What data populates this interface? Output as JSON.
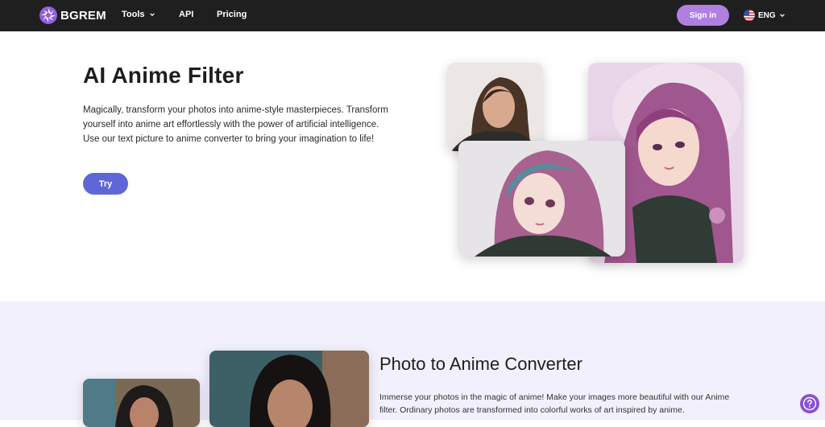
{
  "nav": {
    "logo_text": "BGREM",
    "items": [
      {
        "label": "Tools"
      },
      {
        "label": "API"
      },
      {
        "label": "Pricing"
      }
    ],
    "signin_label": "Sign in",
    "language": "ENG"
  },
  "hero": {
    "title": "AI Anime Filter",
    "description": "Magically, transform your photos into anime-style masterpieces. Transform yourself into anime art effortlessly with the power of artificial intelligence. Use our text picture to anime converter to bring your imagination to life!",
    "try_label": "Try"
  },
  "section2": {
    "title": "Photo to Anime Converter",
    "description": "Immerse your photos in the magic of anime! Make your images more beautiful with our Anime filter. Ordinary photos are transformed into colorful works of art inspired by anime."
  },
  "colors": {
    "nav_bg": "#1f1f1f",
    "signin_bg": "#b07fe2",
    "try_bg": "#5e66d8",
    "section2_bg": "#f1f0fc",
    "help_bg": "#8a4fd6"
  },
  "icons": [
    "logo-mark-icon",
    "chevron-down-icon",
    "us-flag-icon",
    "help-icon"
  ]
}
